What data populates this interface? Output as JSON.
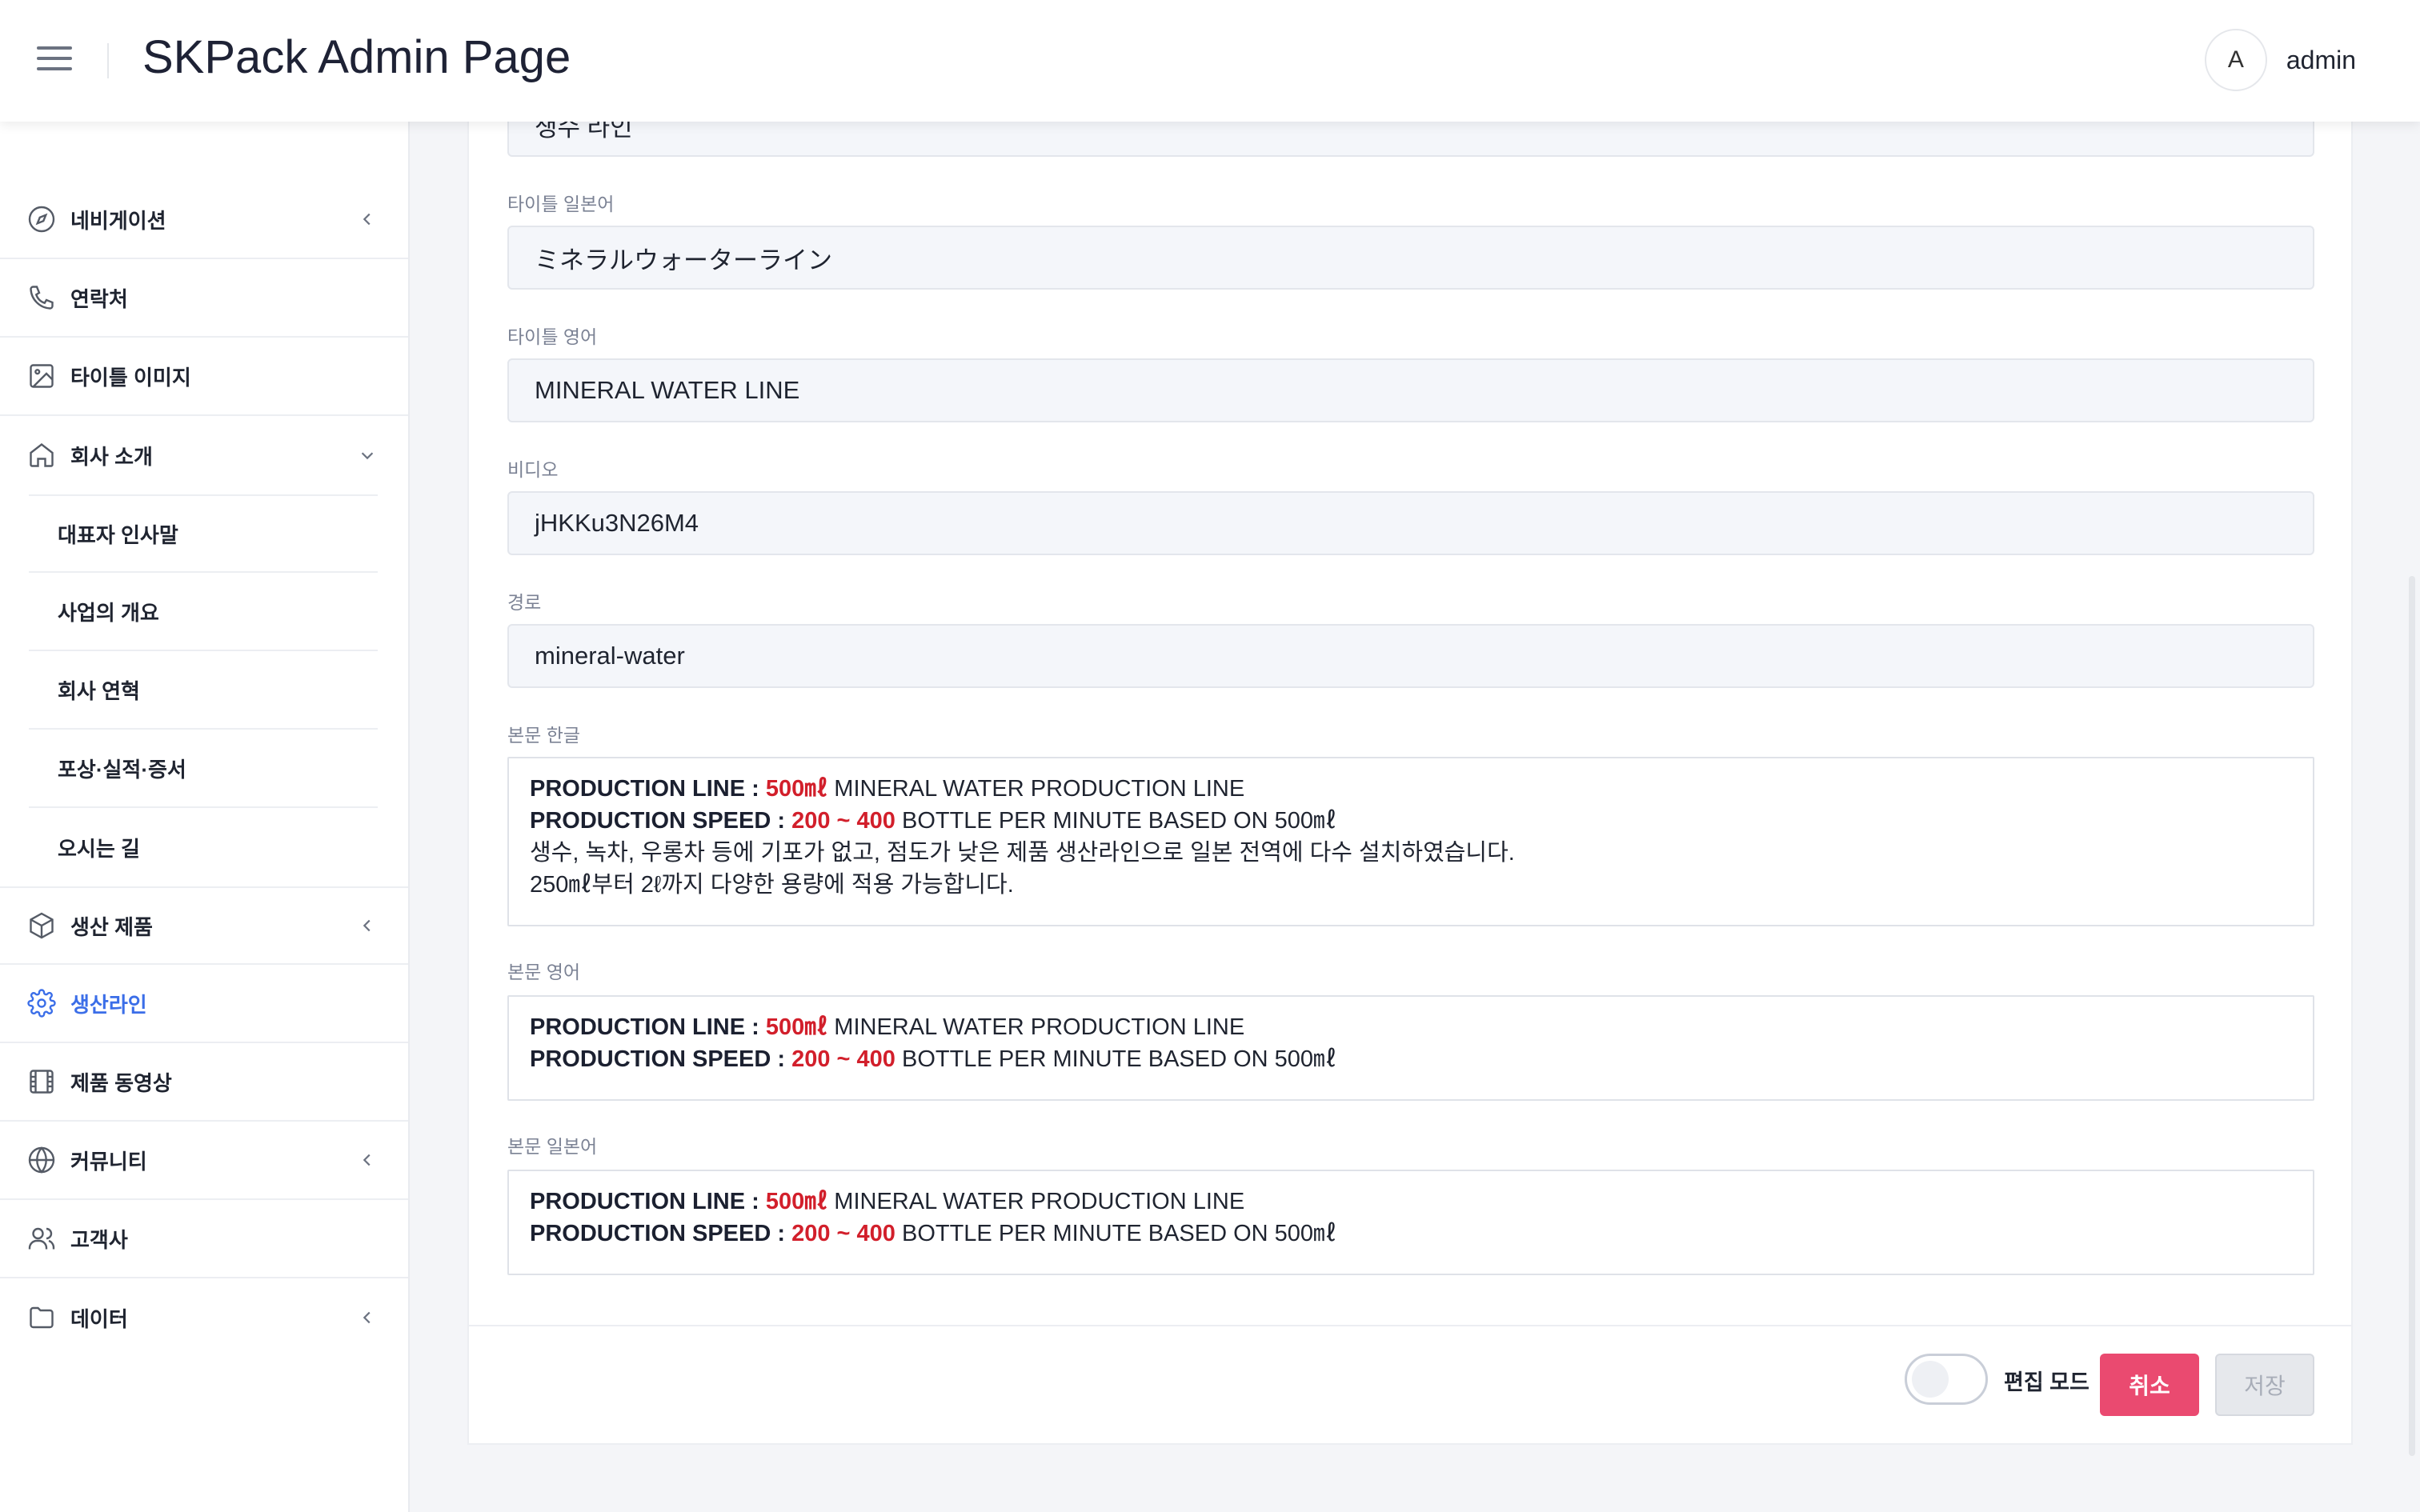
{
  "header": {
    "title": "SKPack Admin Page",
    "avatar_initial": "A",
    "username": "admin"
  },
  "sidebar": {
    "items": [
      {
        "label": "네비게이션",
        "icon": "compass-icon",
        "has_chevron": true
      },
      {
        "label": "연락처",
        "icon": "phone-icon"
      },
      {
        "label": "타이틀 이미지",
        "icon": "image-icon"
      },
      {
        "label": "회사 소개",
        "icon": "home-icon",
        "expanded": true
      },
      {
        "label": "생산 제품",
        "icon": "box-icon",
        "has_chevron": true
      },
      {
        "label": "생산라인",
        "icon": "gear-icon",
        "active": true
      },
      {
        "label": "제품 동영상",
        "icon": "film-icon"
      },
      {
        "label": "커뮤니티",
        "icon": "globe-icon",
        "has_chevron": true
      },
      {
        "label": "고객사",
        "icon": "users-icon"
      },
      {
        "label": "데이터",
        "icon": "folder-icon",
        "has_chevron": true
      }
    ],
    "sub_items": [
      "대표자 인사말",
      "사업의 개요",
      "회사 연혁",
      "포상·실적·증서",
      "오시는 길"
    ],
    "active_color": "#3b6ee8"
  },
  "form": {
    "top_partial_value": "생수 라인",
    "title_jp_label": "타이틀 일본어",
    "title_jp_value": "ミネラルウォーターライン",
    "title_en_label": "타이틀 영어",
    "title_en_value": "MINERAL WATER LINE",
    "video_label": "비디오",
    "video_value": "jHKKu3N26M4",
    "path_label": "경로",
    "path_value": "mineral-water",
    "body_ko_label": "본문 한글",
    "body_en_label": "본문 영어",
    "body_jp_label": "본문 일본어",
    "body": {
      "line1_bold": "PRODUCTION LINE : ",
      "line1_red": "500㎖",
      "line1_rest": " MINERAL WATER PRODUCTION LINE",
      "line2_bold": "PRODUCTION SPEED : ",
      "line2_red": "200 ~ 400",
      "line2_rest": " BOTTLE PER MINUTE BASED ON 500㎖",
      "ko_line3": "생수, 녹차, 우롱차 등에 기포가 없고, 점도가 낮은 제품 생산라인으로 일본 전역에 다수 설치하였습니다.",
      "ko_line4": "250㎖부터 2ℓ까지 다양한 용량에 적용 가능합니다."
    },
    "accent_red": "#d21f2b"
  },
  "footer": {
    "toggle_label": "편집 모드",
    "toggle_on": false,
    "cancel_label": "취소",
    "save_label": "저장",
    "cancel_color": "#ea4a70"
  }
}
